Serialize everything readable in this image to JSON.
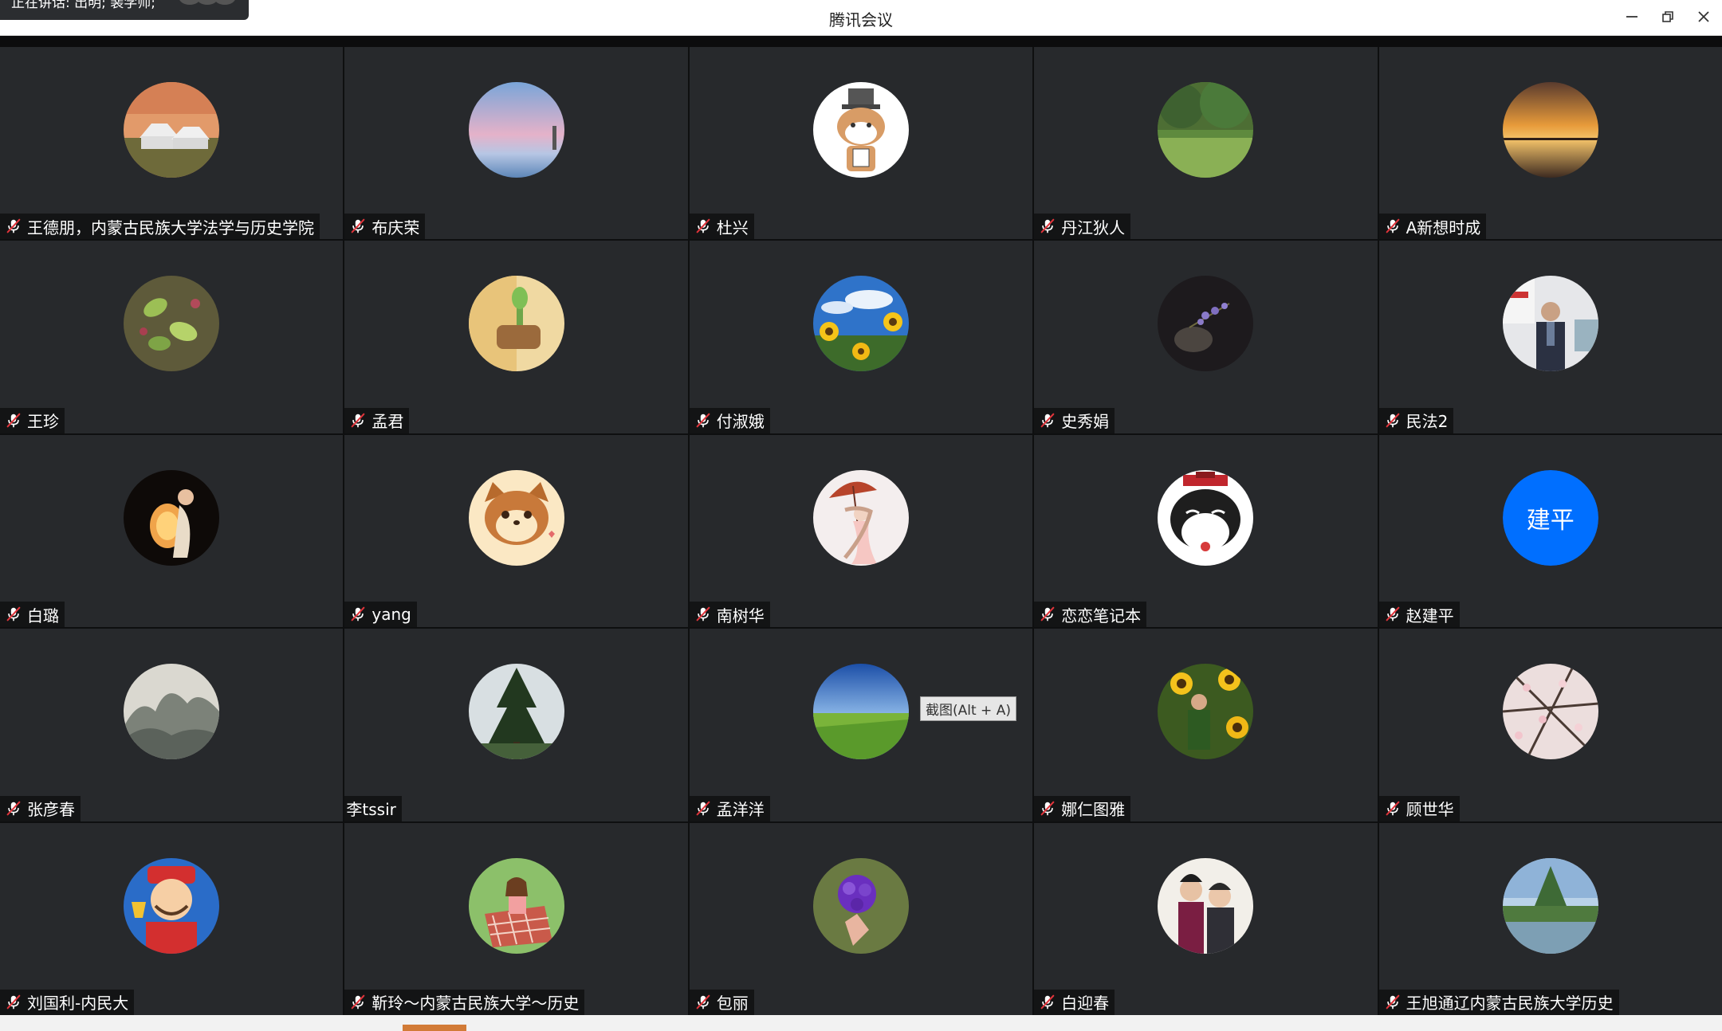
{
  "window": {
    "title": "腾讯会议",
    "speaking_prefix": "正在讲话: 出明; 裴学师;"
  },
  "colors": {
    "tile_bg": "#27292c",
    "mic_muted": "#e0343b",
    "avatar_blue": "#006fff"
  },
  "tooltip": "截图(Alt + A)",
  "participants": [
    {
      "name": "王德朋，内蒙古民族大学法学与历史学院",
      "muted": true,
      "avatar": "yurt-landscape-photo"
    },
    {
      "name": "布庆荣",
      "muted": true,
      "avatar": "pink-sky-sea-photo"
    },
    {
      "name": "杜兴",
      "muted": true,
      "avatar": "cartoon-cat-hat"
    },
    {
      "name": "丹江狄人",
      "muted": true,
      "avatar": "green-trees-lawn-photo"
    },
    {
      "name": "A新想时成",
      "muted": true,
      "avatar": "sunset-lake-photo"
    },
    {
      "name": "王珍",
      "muted": true,
      "avatar": "green-leaves-photo"
    },
    {
      "name": "孟君",
      "muted": true,
      "avatar": "warm-room-plant-photo"
    },
    {
      "name": "付淑娥",
      "muted": true,
      "avatar": "sunflowers-blue-sky-photo"
    },
    {
      "name": "史秀娟",
      "muted": true,
      "avatar": "lavender-vase-dark-photo"
    },
    {
      "name": "民法2",
      "muted": true,
      "avatar": "man-in-office-photo"
    },
    {
      "name": "白璐",
      "muted": true,
      "avatar": "woman-lantern-dark-photo"
    },
    {
      "name": "yang",
      "muted": true,
      "avatar": "cartoon-squirrel"
    },
    {
      "name": "南树华",
      "muted": true,
      "avatar": "girl-umbrella-illustration"
    },
    {
      "name": "恋恋笔记本",
      "muted": true,
      "avatar": "cartoon-cat-emperor"
    },
    {
      "name": "赵建平",
      "muted": true,
      "avatar": "initials",
      "initials": "建平"
    },
    {
      "name": "张彦春",
      "muted": true,
      "avatar": "ink-landscape-painting"
    },
    {
      "name": "李tssir",
      "muted": false,
      "avatar": "pine-tree-photo"
    },
    {
      "name": "孟洋洋",
      "muted": true,
      "avatar": "green-field-blue-sky-photo"
    },
    {
      "name": "娜仁图雅",
      "muted": true,
      "avatar": "woman-sunflowers-photo"
    },
    {
      "name": "顾世华",
      "muted": true,
      "avatar": "cherry-blossom-photo"
    },
    {
      "name": "刘国利-内民大",
      "muted": true,
      "avatar": "cartoon-god-of-wealth"
    },
    {
      "name": "靳玲～内蒙古民族大学～历史",
      "muted": true,
      "avatar": "girl-picnic-illustration"
    },
    {
      "name": "包丽",
      "muted": true,
      "avatar": "purple-flower-photo"
    },
    {
      "name": "白迎春",
      "muted": true,
      "avatar": "two-people-photo"
    },
    {
      "name": "王旭通辽内蒙古民族大学历史",
      "muted": true,
      "avatar": "tree-lake-photo"
    }
  ]
}
